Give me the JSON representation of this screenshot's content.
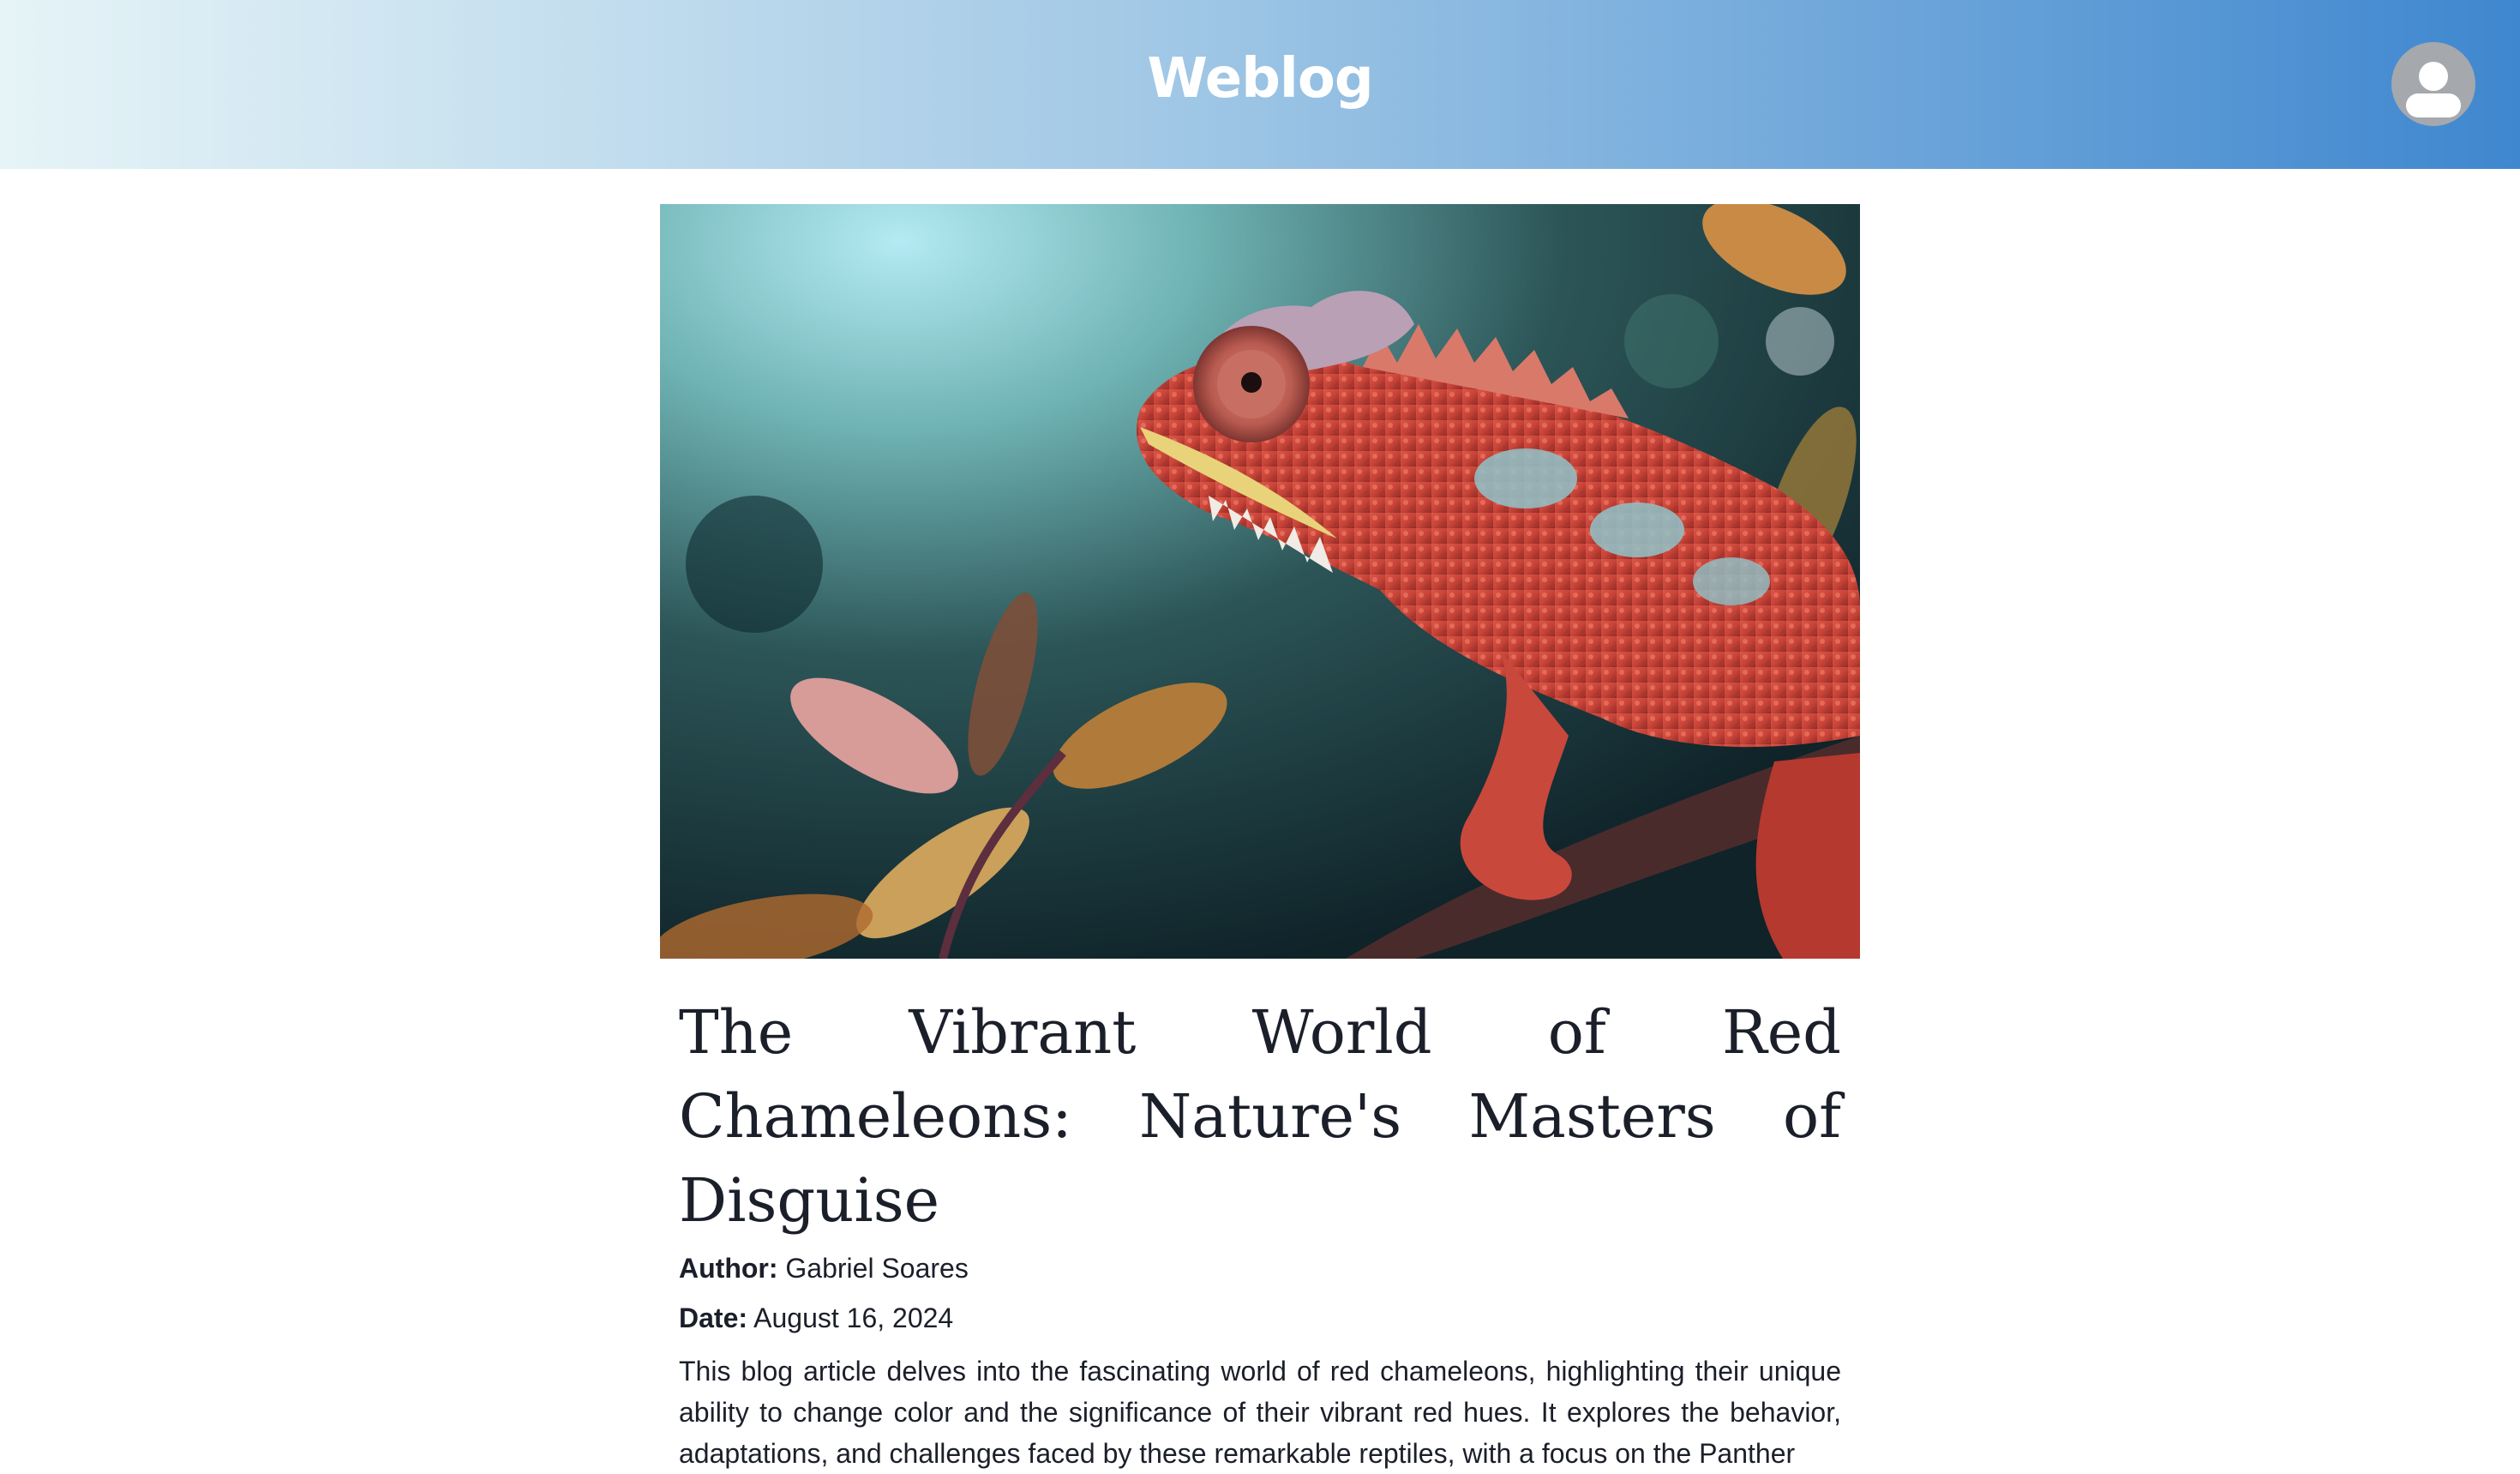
{
  "header": {
    "brand": "Weblog",
    "avatar_icon": "user-avatar-icon",
    "gradient_colors": [
      "#e6f4f7",
      "#a3c9e6",
      "#3f87cf"
    ]
  },
  "hero_image": {
    "subject": "red chameleon on a branch"
  },
  "article": {
    "title": "The Vibrant World of Red Chameleons: Nature's Masters of Disguise",
    "author_label": "Author:",
    "author": "Gabriel Soares",
    "date_label": "Date:",
    "date": "August 16, 2024",
    "summary": "This blog article delves into the fascinating world of red chameleons, highlighting their unique ability to change color and the significance of their vibrant red hues. It explores the behavior, adaptations, and challenges faced by these remarkable reptiles, with a focus on the Panther"
  }
}
